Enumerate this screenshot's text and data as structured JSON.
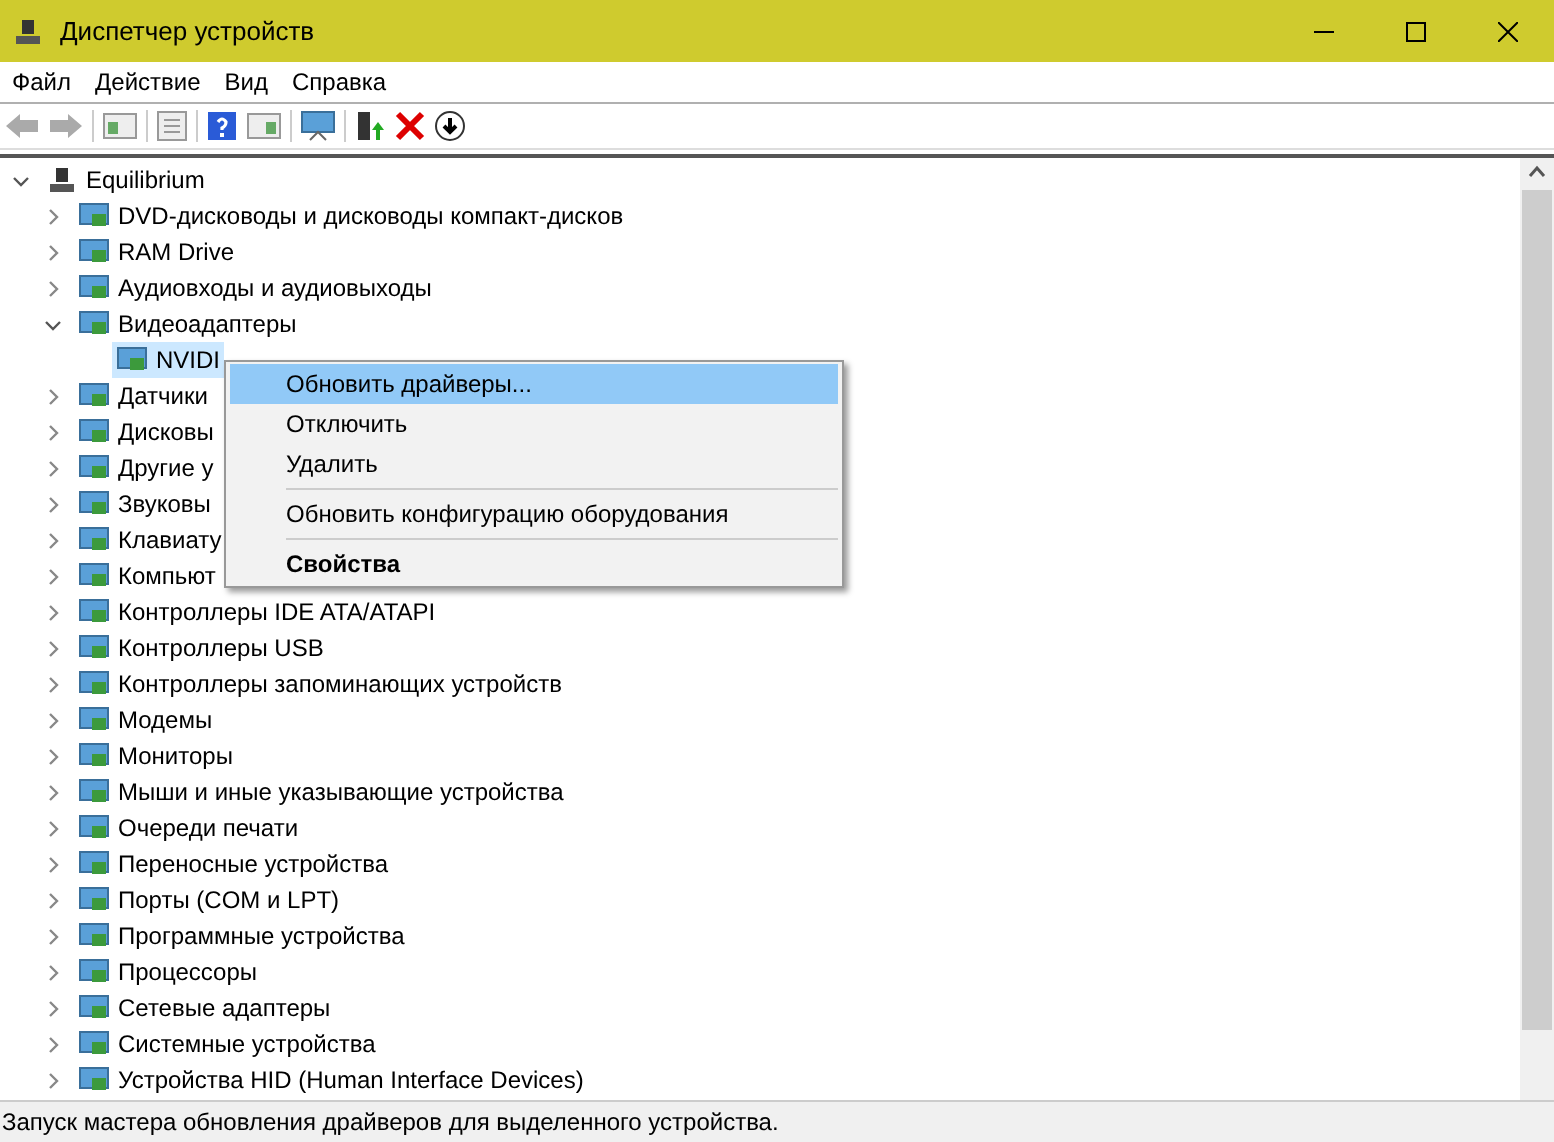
{
  "window": {
    "title": "Диспетчер устройств"
  },
  "menu_bar": [
    "Файл",
    "Действие",
    "Вид",
    "Справка"
  ],
  "tree": {
    "label": "Equilibrium",
    "expanded": true,
    "selected": false,
    "children": [
      {
        "label": "DVD-дисководы и дисководы компакт-дисков",
        "expanded": false,
        "selected": false
      },
      {
        "label": "RAM Drive",
        "expanded": false,
        "selected": false
      },
      {
        "label": "Аудиовходы и аудиовыходы",
        "expanded": false,
        "selected": false
      },
      {
        "label": "Видеоадаптеры",
        "expanded": true,
        "selected": false,
        "children": [
          {
            "label": "NVIDI",
            "selected": true
          }
        ]
      },
      {
        "label": "Датчики",
        "expanded": false,
        "selected": false
      },
      {
        "label": "Дисковы",
        "expanded": false,
        "selected": false
      },
      {
        "label": "Другие у",
        "expanded": false,
        "selected": false
      },
      {
        "label": "Звуковы",
        "expanded": false,
        "selected": false
      },
      {
        "label": "Клавиату",
        "expanded": false,
        "selected": false
      },
      {
        "label": "Компьют",
        "expanded": false,
        "selected": false
      },
      {
        "label": "Контроллеры IDE ATA/ATAPI",
        "expanded": false,
        "selected": false
      },
      {
        "label": "Контроллеры USB",
        "expanded": false,
        "selected": false
      },
      {
        "label": "Контроллеры запоминающих устройств",
        "expanded": false,
        "selected": false
      },
      {
        "label": "Модемы",
        "expanded": false,
        "selected": false
      },
      {
        "label": "Мониторы",
        "expanded": false,
        "selected": false
      },
      {
        "label": "Мыши и иные указывающие устройства",
        "expanded": false,
        "selected": false
      },
      {
        "label": "Очереди печати",
        "expanded": false,
        "selected": false
      },
      {
        "label": "Переносные устройства",
        "expanded": false,
        "selected": false
      },
      {
        "label": "Порты (COM и LPT)",
        "expanded": false,
        "selected": false
      },
      {
        "label": "Программные устройства",
        "expanded": false,
        "selected": false
      },
      {
        "label": "Процессоры",
        "expanded": false,
        "selected": false
      },
      {
        "label": "Сетевые адаптеры",
        "expanded": false,
        "selected": false
      },
      {
        "label": "Системные устройства",
        "expanded": false,
        "selected": false
      },
      {
        "label": "Устройства HID (Human Interface Devices)",
        "expanded": false,
        "selected": false
      }
    ]
  },
  "context_menu": [
    {
      "kind": "item",
      "label": "Обновить драйверы...",
      "selected": true,
      "default": false
    },
    {
      "kind": "item",
      "label": "Отключить",
      "selected": false,
      "default": false
    },
    {
      "kind": "item",
      "label": "Удалить",
      "selected": false,
      "default": false
    },
    {
      "kind": "separator"
    },
    {
      "kind": "item",
      "label": "Обновить конфигурацию оборудования",
      "selected": false,
      "default": false
    },
    {
      "kind": "separator"
    },
    {
      "kind": "item",
      "label": "Свойства",
      "selected": false,
      "default": true
    }
  ],
  "status_bar": "Запуск мастера обновления драйверов для выделенного устройства."
}
